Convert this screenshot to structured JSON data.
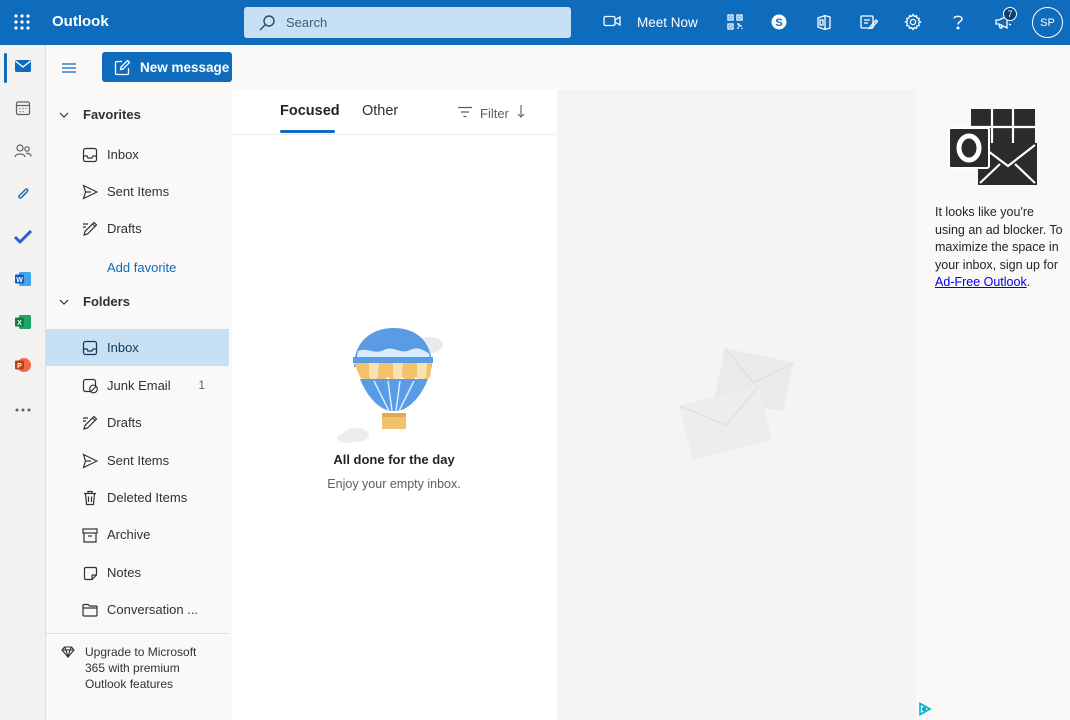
{
  "topbar": {
    "brand": "Outlook",
    "search_placeholder": "Search",
    "meet_now_label": "Meet Now",
    "notification_count": "7",
    "avatar_initials": "SP",
    "accent_color": "#0f6cbd"
  },
  "rail": {
    "items": [
      "mail-icon",
      "calendar-icon",
      "people-icon",
      "attachment-icon",
      "todo-icon",
      "word-icon",
      "excel-icon",
      "powerpoint-icon",
      "more-apps-icon"
    ]
  },
  "commands": {
    "new_message_label": "New message"
  },
  "folders": {
    "favorites_label": "Favorites",
    "favorites": [
      {
        "label": "Inbox",
        "icon": "inbox-icon"
      },
      {
        "label": "Sent Items",
        "icon": "send-icon"
      },
      {
        "label": "Drafts",
        "icon": "drafts-icon"
      }
    ],
    "add_favorite_label": "Add favorite",
    "folders_label": "Folders",
    "items": [
      {
        "label": "Inbox",
        "icon": "inbox-icon",
        "count": ""
      },
      {
        "label": "Junk Email",
        "icon": "junk-icon",
        "count": "1"
      },
      {
        "label": "Drafts",
        "icon": "drafts-icon",
        "count": ""
      },
      {
        "label": "Sent Items",
        "icon": "send-icon",
        "count": ""
      },
      {
        "label": "Deleted Items",
        "icon": "trash-icon",
        "count": ""
      },
      {
        "label": "Archive",
        "icon": "archive-icon",
        "count": ""
      },
      {
        "label": "Notes",
        "icon": "notes-icon",
        "count": ""
      },
      {
        "label": "Conversation ...",
        "icon": "folder-icon",
        "count": ""
      }
    ],
    "upgrade_text": "Upgrade to Microsoft 365 with premium Outlook features"
  },
  "message_list": {
    "tab_focused": "Focused",
    "tab_other": "Other",
    "filter_label": "Filter",
    "empty_title": "All done for the day",
    "empty_subtitle": "Enjoy your empty inbox."
  },
  "ad": {
    "text_before": "It looks like you're using an ad blocker. To maximize the space in your inbox, sign up for ",
    "link_text": "Ad-Free Outlook",
    "text_after": "."
  }
}
